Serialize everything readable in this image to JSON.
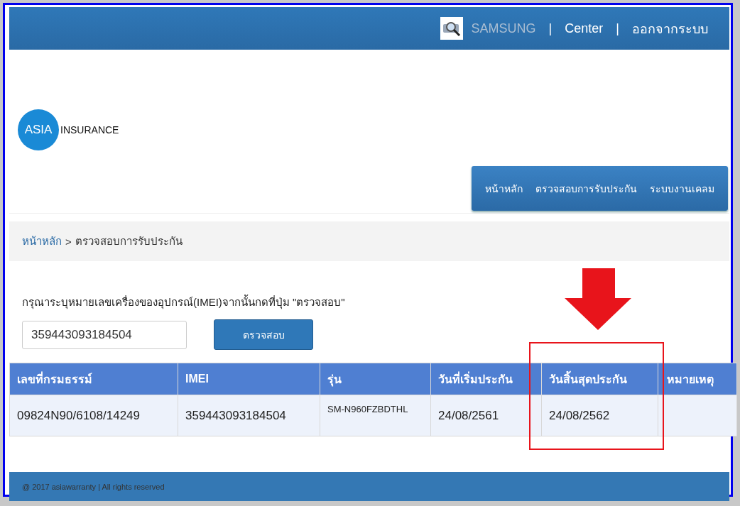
{
  "header": {
    "items": [
      {
        "kind": "user",
        "text": "SAMSUNG"
      },
      {
        "kind": "separator",
        "text": "|"
      },
      {
        "kind": "link",
        "text": "Center"
      },
      {
        "kind": "separator",
        "text": "|"
      },
      {
        "kind": "link",
        "text": "ออกจากระบบ"
      }
    ]
  },
  "logo": {
    "mark": "ASIA",
    "word": "INSURANCE"
  },
  "nav": {
    "items": [
      {
        "label": "หน้าหลัก",
        "selected": false
      },
      {
        "label": "ตรวจสอบการรับประกัน",
        "selected": false
      },
      {
        "label": "ระบบงานเคลม",
        "selected": false
      }
    ]
  },
  "breadcrumb": {
    "link": "หน้าหลัก",
    "separator": ">",
    "current": "ตรวจสอบการรับประกัน"
  },
  "form": {
    "instruction": "กรุณาระบุหมายเลขเครื่องของอุปกรณ์(IMEI)จากนั้นกดที่ปุ่ม \"ตรวจสอบ\"",
    "value": "359443093184504",
    "button": "ตรวจสอบ"
  },
  "table": {
    "columns": [
      "เลขที่กรมธรรม์",
      "IMEI",
      "รุ่น",
      "วันที่เริ่มประกัน",
      "วันสิ้นสุดประกัน",
      "หมายเหตุ"
    ],
    "rows": [
      [
        "09824N90/6108/14249",
        "359443093184504",
        "SM-N960FZBDTHL",
        "24/08/2561",
        "24/08/2562",
        ""
      ]
    ]
  },
  "footer": {
    "text": "@ 2017 asiawarranty | All rights reserved"
  }
}
